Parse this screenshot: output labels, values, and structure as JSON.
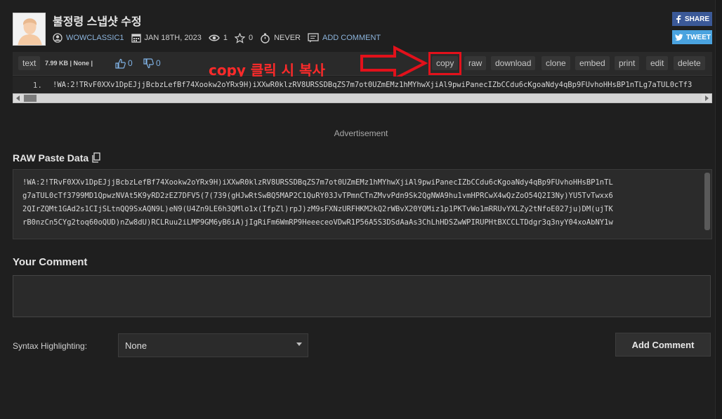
{
  "paste": {
    "title": "불정령 스냅샷 수정",
    "author": "WOWCLASSIC1",
    "date": "JAN 18TH, 2023",
    "views": "1",
    "stars": "0",
    "expiry": "NEVER",
    "add_comment_link": "ADD COMMENT"
  },
  "social": {
    "share_label": "SHARE",
    "tweet_label": "TWEET"
  },
  "toolbar": {
    "syntax_label": "text",
    "info": "7.99 KB  |  None  |",
    "likes": "0",
    "dislikes": "0",
    "buttons": {
      "copy": "copy",
      "raw": "raw",
      "download": "download",
      "clone": "clone",
      "embed": "embed",
      "print": "print",
      "edit": "edit",
      "delete": "delete"
    }
  },
  "annotation": {
    "text": "copy 클릭 시 복사"
  },
  "code": {
    "line_number": "1.",
    "line_text": "!WA:2!TRvF0XXv1DpEJjjBcbzLefBf74Xookw2oYRx9H)iXXwR0klzRV8URSSDBqZS7m7ot0UZmEMz1hMYhwXjiAl9pwiPanecIZbCCdu6cKgoaNdy4qBp9FUvhoHHsBP1nTLg7aTUL0cTf3"
  },
  "advertisement": "Advertisement",
  "raw_section": {
    "title": "RAW Paste Data",
    "lines": [
      "!WA:2!TRvF0XXv1DpEJjjBcbzLefBf74Xookw2oYRx9H)iXXwR0klzRV8URSSDBqZS7m7ot0UZmEMz1hMYhwXjiAl9pwiPanecIZbCCdu6cKgoaNdy4qBp9FUvhoHHsBP1nTL",
      "g7aTUL0cTf3799MD1QpwzNVAt5K9yRD2zEZ7DFV5(7(739(gHJwRtSwBQ5MAP2C1QuRY03JvTPmnCTnZMvvPdn9Sk2QgNWA9hu1vmHPRCwX4wQzZoO54Q2I3Ny)YU5TvTwxx6",
      "2QIrZQMt1GAd2s1CIjSLtnQQ9SxAQN9L)eN9(U4Zn9LE6h3QMlo1x(IfpZl)rpJ)zM9sFXNzURFHKM2kQ2rWBvX20YQMiz1p1PKTvWo1mRRUvYXLZy2tNfoE027ju)DM(ujTK",
      "rB0nzCn5CYg2toq60oQUD)nZw8dU)RCLRuu2iLMP9GM6yB6iA)jIgRiFm6WmRP9HeeeceoVDwR1P56A5S3DSdAaAs3ChLhHDSZwWPIRUPHtBXCCLTDdgr3q3nyY04xoAbNY1w"
    ]
  },
  "comment_section": {
    "title": "Your Comment",
    "placeholder": ""
  },
  "syntax": {
    "label": "Syntax Highlighting:",
    "selected": "None"
  },
  "add_comment_button": "Add Comment",
  "colors": {
    "background": "#1f1f1f",
    "accent_link": "#8cb4dc",
    "annotation_red": "#e2111b",
    "share_blue": "#3b5998",
    "tweet_blue": "#4aa3df"
  }
}
